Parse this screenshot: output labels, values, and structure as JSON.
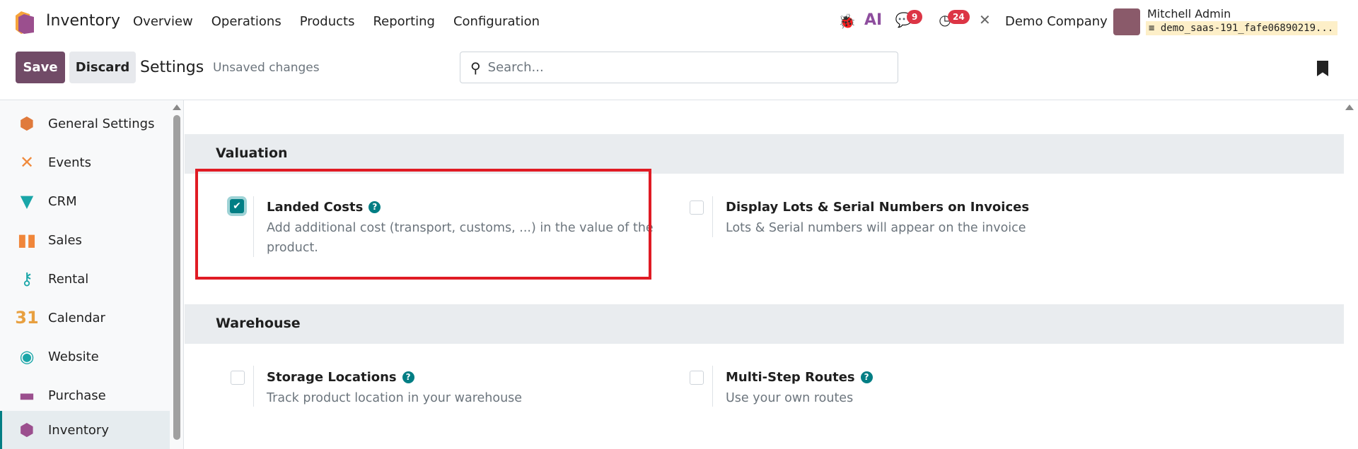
{
  "navbar": {
    "app_name": "Inventory",
    "menu": [
      "Overview",
      "Operations",
      "Products",
      "Reporting",
      "Configuration"
    ],
    "messages_count": "9",
    "activities_count": "24",
    "company": "Demo Company",
    "user": "Mitchell Admin",
    "database": "demo_saas-191_fafe06890219...",
    "ai_label": "AI"
  },
  "control_panel": {
    "save": "Save",
    "discard": "Discard",
    "breadcrumb": "Settings",
    "status": "Unsaved changes",
    "search_placeholder": "Search..."
  },
  "sidebar": {
    "items": [
      {
        "label": "General Settings"
      },
      {
        "label": "Events"
      },
      {
        "label": "CRM"
      },
      {
        "label": "Sales"
      },
      {
        "label": "Rental"
      },
      {
        "label": "Calendar",
        "icon_text": "31"
      },
      {
        "label": "Website"
      },
      {
        "label": "Purchase"
      },
      {
        "label": "Inventory",
        "active": true
      }
    ]
  },
  "sections": [
    {
      "title": "Valuation",
      "settings": [
        {
          "title": "Landed Costs",
          "checked": true,
          "help": true,
          "description_lines": [
            "Add additional cost (transport, customs, ...) in the value of the",
            "product."
          ]
        },
        {
          "title": "Display Lots & Serial Numbers on Invoices",
          "checked": false,
          "help": false,
          "description_lines": [
            "Lots & Serial numbers will appear on the invoice"
          ]
        }
      ]
    },
    {
      "title": "Warehouse",
      "settings": [
        {
          "title": "Storage Locations",
          "checked": false,
          "help": true,
          "description_lines": [
            "Track product location in your warehouse"
          ]
        },
        {
          "title": "Multi-Step Routes",
          "checked": false,
          "help": true,
          "description_lines": [
            "Use your own routes"
          ]
        }
      ]
    }
  ],
  "colors": {
    "primary": "#714b67",
    "accent": "#017e84",
    "highlight": "#e01b24"
  }
}
